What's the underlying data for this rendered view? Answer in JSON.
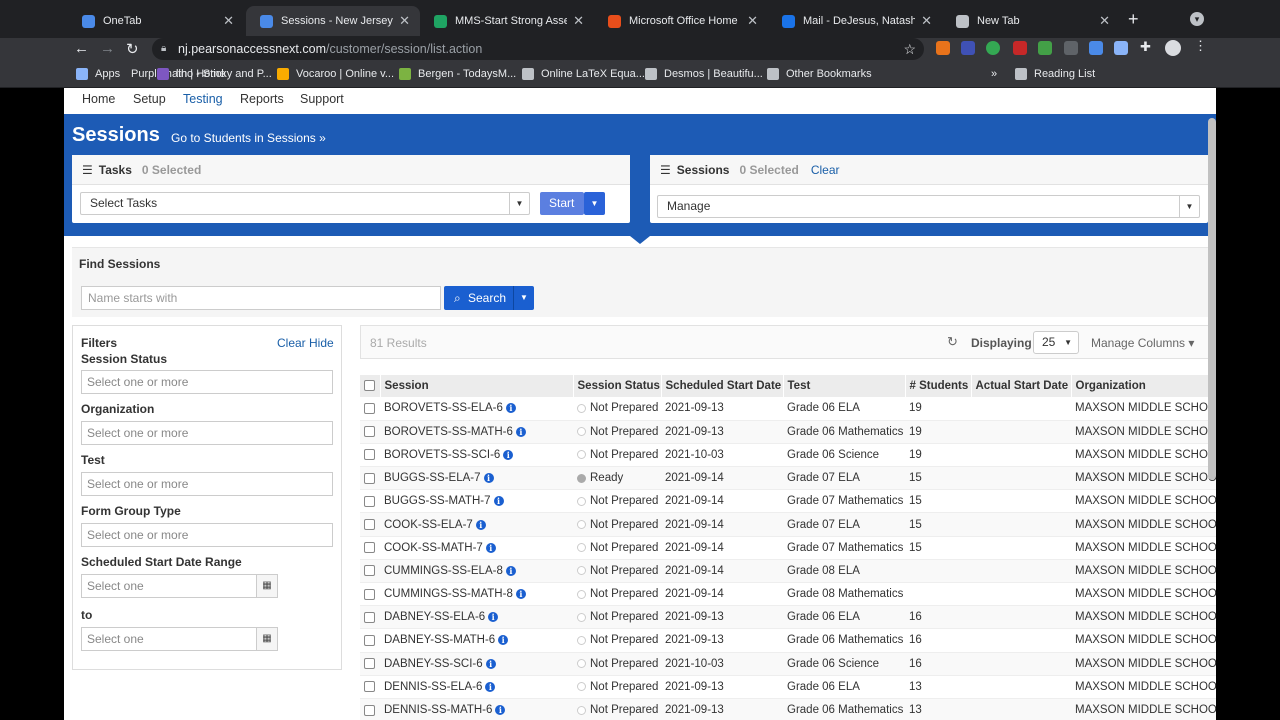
{
  "tabs": [
    {
      "title": "OneTab",
      "color": "#4a8ae8"
    },
    {
      "title": "Sessions - New Jersey Ass",
      "color": "#4a8ae8",
      "active": true
    },
    {
      "title": "MMS-Start Strong Assessm",
      "color": "#1fa463"
    },
    {
      "title": "Microsoft Office Home",
      "color": "#e84e1b"
    },
    {
      "title": "Mail - DeJesus, Natasha - (",
      "color": "#1a73e8"
    },
    {
      "title": "New Tab",
      "color": "#bdc1c6"
    }
  ],
  "address": {
    "host": "nj.pearsonaccessnext.com",
    "path": "/customer/session/list.action"
  },
  "bookmarks": [
    "Apps",
    "Purplemath | Home",
    "lino - Sticky and P...",
    "Vocaroo | Online v...",
    "Bergen - TodaysM...",
    "Online LaTeX Equa...",
    "Desmos | Beautifu...",
    "Other Bookmarks",
    "Reading List"
  ],
  "nav": {
    "home": "Home",
    "setup": "Setup",
    "testing": "Testing",
    "reports": "Reports",
    "support": "Support"
  },
  "banner": {
    "title": "Sessions",
    "link": "Go to Students in Sessions »"
  },
  "tasks": {
    "label": "Tasks",
    "selected": "0 Selected",
    "select": "Select Tasks",
    "start": "Start"
  },
  "sessions_panel": {
    "label": "Sessions",
    "selected": "0 Selected",
    "clear": "Clear",
    "manage": "Manage"
  },
  "find": {
    "title": "Find Sessions",
    "placeholder": "Name starts with",
    "search": "Search"
  },
  "filters": {
    "title": "Filters",
    "clear": "Clear",
    "hide": "Hide",
    "status": "Session Status",
    "org": "Organization",
    "test": "Test",
    "form": "Form Group Type",
    "range": "Scheduled Start Date Range",
    "to": "to",
    "multi_placeholder": "Select one or more",
    "single_placeholder": "Select one"
  },
  "results": {
    "count": "81 Results",
    "displaying": "Displaying",
    "page_size": "25",
    "manage_columns": "Manage Columns"
  },
  "columns": [
    "Session",
    "Session Status",
    "Scheduled Start Date",
    "Test",
    "# Students",
    "Actual Start Date",
    "Organization"
  ],
  "rows": [
    [
      "BOROVETS-SS-ELA-6",
      "Not Prepared",
      "2021-09-13",
      "Grade 06 ELA",
      "19",
      "",
      "MAXSON MIDDLE SCHOOL"
    ],
    [
      "BOROVETS-SS-MATH-6",
      "Not Prepared",
      "2021-09-13",
      "Grade 06 Mathematics",
      "19",
      "",
      "MAXSON MIDDLE SCHOOL"
    ],
    [
      "BOROVETS-SS-SCI-6",
      "Not Prepared",
      "2021-10-03",
      "Grade 06 Science",
      "19",
      "",
      "MAXSON MIDDLE SCHOOL"
    ],
    [
      "BUGGS-SS-ELA-7",
      "Ready",
      "2021-09-14",
      "Grade 07 ELA",
      "15",
      "",
      "MAXSON MIDDLE SCHOOL"
    ],
    [
      "BUGGS-SS-MATH-7",
      "Not Prepared",
      "2021-09-14",
      "Grade 07 Mathematics",
      "15",
      "",
      "MAXSON MIDDLE SCHOOL"
    ],
    [
      "COOK-SS-ELA-7",
      "Not Prepared",
      "2021-09-14",
      "Grade 07 ELA",
      "15",
      "",
      "MAXSON MIDDLE SCHOOL"
    ],
    [
      "COOK-SS-MATH-7",
      "Not Prepared",
      "2021-09-14",
      "Grade 07 Mathematics",
      "15",
      "",
      "MAXSON MIDDLE SCHOOL"
    ],
    [
      "CUMMINGS-SS-ELA-8",
      "Not Prepared",
      "2021-09-14",
      "Grade 08 ELA",
      "",
      "",
      "MAXSON MIDDLE SCHOOL"
    ],
    [
      "CUMMINGS-SS-MATH-8",
      "Not Prepared",
      "2021-09-14",
      "Grade 08 Mathematics",
      "",
      "",
      "MAXSON MIDDLE SCHOOL"
    ],
    [
      "DABNEY-SS-ELA-6",
      "Not Prepared",
      "2021-09-13",
      "Grade 06 ELA",
      "16",
      "",
      "MAXSON MIDDLE SCHOOL"
    ],
    [
      "DABNEY-SS-MATH-6",
      "Not Prepared",
      "2021-09-13",
      "Grade 06 Mathematics",
      "16",
      "",
      "MAXSON MIDDLE SCHOOL"
    ],
    [
      "DABNEY-SS-SCI-6",
      "Not Prepared",
      "2021-10-03",
      "Grade 06 Science",
      "16",
      "",
      "MAXSON MIDDLE SCHOOL"
    ],
    [
      "DENNIS-SS-ELA-6",
      "Not Prepared",
      "2021-09-13",
      "Grade 06 ELA",
      "13",
      "",
      "MAXSON MIDDLE SCHOOL"
    ],
    [
      "DENNIS-SS-MATH-6",
      "Not Prepared",
      "2021-09-13",
      "Grade 06 Mathematics",
      "13",
      "",
      "MAXSON MIDDLE SCHOOL"
    ]
  ]
}
